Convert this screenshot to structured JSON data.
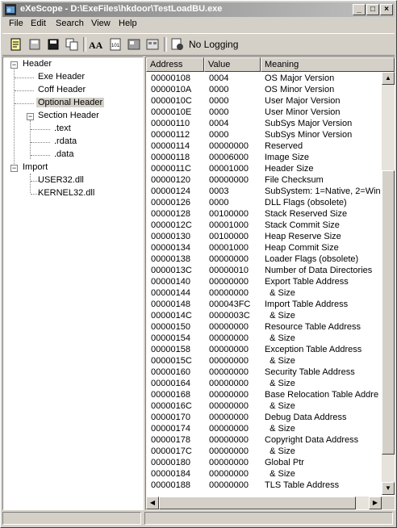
{
  "window": {
    "title": "eXeScope - D:\\ExeFiles\\hkdoor\\TestLoadBU.exe",
    "controls": [
      "minimize",
      "maximize",
      "close"
    ]
  },
  "menu": [
    {
      "label": "File",
      "enabled": true
    },
    {
      "label": "Edit",
      "enabled": true
    },
    {
      "label": "Search",
      "enabled": true
    },
    {
      "label": "View",
      "enabled": true
    },
    {
      "label": "Help",
      "enabled": true
    }
  ],
  "toolbar": {
    "icons": [
      "open-icon",
      "save-icon",
      "save-as-icon",
      "copy-icon",
      "font-icon",
      "binary-icon",
      "image-icon",
      "resource-icon",
      "logging-icon"
    ],
    "logging_label": "No Logging"
  },
  "tree": {
    "nodes": [
      {
        "label": "Header",
        "level": 0,
        "expander": "-"
      },
      {
        "label": "Exe Header",
        "level": 1
      },
      {
        "label": "Coff Header",
        "level": 1
      },
      {
        "label": "Optional Header",
        "level": 1,
        "selected": true
      },
      {
        "label": "Section Header",
        "level": 1,
        "expander": "-"
      },
      {
        "label": ".text",
        "level": 2
      },
      {
        "label": ".rdata",
        "level": 2
      },
      {
        "label": ".data",
        "level": 2
      },
      {
        "label": "Import",
        "level": 0,
        "expander": "-"
      },
      {
        "label": "USER32.dll",
        "level": 1
      },
      {
        "label": "KERNEL32.dll",
        "level": 1
      }
    ]
  },
  "list": {
    "columns": [
      "Address",
      "Value",
      "Meaning"
    ],
    "rows": [
      [
        "00000108",
        "0004",
        "OS Major Version"
      ],
      [
        "0000010A",
        "0000",
        "OS Minor Version"
      ],
      [
        "0000010C",
        "0000",
        "User Major Version"
      ],
      [
        "0000010E",
        "0000",
        "User Minor Version"
      ],
      [
        "00000110",
        "0004",
        "SubSys Major Version"
      ],
      [
        "00000112",
        "0000",
        "SubSys Minor Version"
      ],
      [
        "00000114",
        "00000000",
        "Reserved"
      ],
      [
        "00000118",
        "00006000",
        "Image Size"
      ],
      [
        "0000011C",
        "00001000",
        "Header Size"
      ],
      [
        "00000120",
        "00000000",
        "File Checksum"
      ],
      [
        "00000124",
        "0003",
        "SubSystem: 1=Native, 2=Win"
      ],
      [
        "00000126",
        "0000",
        "DLL Flags (obsolete)"
      ],
      [
        "00000128",
        "00100000",
        "Stack Reserved Size"
      ],
      [
        "0000012C",
        "00001000",
        "Stack Commit Size"
      ],
      [
        "00000130",
        "00100000",
        "Heap Reserve Size"
      ],
      [
        "00000134",
        "00001000",
        "Heap Commit Size"
      ],
      [
        "00000138",
        "00000000",
        "Loader Flags (obsolete)"
      ],
      [
        "0000013C",
        "00000010",
        "Number of Data Directories"
      ],
      [
        "00000140",
        "00000000",
        "Export Table Address"
      ],
      [
        "00000144",
        "00000000",
        "  & Size"
      ],
      [
        "00000148",
        "000043FC",
        "Import Table Address"
      ],
      [
        "0000014C",
        "0000003C",
        "  & Size"
      ],
      [
        "00000150",
        "00000000",
        "Resource Table Address"
      ],
      [
        "00000154",
        "00000000",
        "  & Size"
      ],
      [
        "00000158",
        "00000000",
        "Exception Table Address"
      ],
      [
        "0000015C",
        "00000000",
        "  & Size"
      ],
      [
        "00000160",
        "00000000",
        "Security Table Address"
      ],
      [
        "00000164",
        "00000000",
        "  & Size"
      ],
      [
        "00000168",
        "00000000",
        "Base Relocation Table Addre"
      ],
      [
        "0000016C",
        "00000000",
        "  & Size"
      ],
      [
        "00000170",
        "00000000",
        "Debug Data Address"
      ],
      [
        "00000174",
        "00000000",
        "  & Size"
      ],
      [
        "00000178",
        "00000000",
        "Copyright Data Address"
      ],
      [
        "0000017C",
        "00000000",
        "  & Size"
      ],
      [
        "00000180",
        "00000000",
        "Global Ptr"
      ],
      [
        "00000184",
        "00000000",
        "  & Size"
      ],
      [
        "00000188",
        "00000000",
        "TLS Table Address"
      ]
    ]
  },
  "colors": {
    "selection": "#d4d0c8",
    "titlebar_start": "#808080",
    "titlebar_end": "#c0c0c0"
  }
}
